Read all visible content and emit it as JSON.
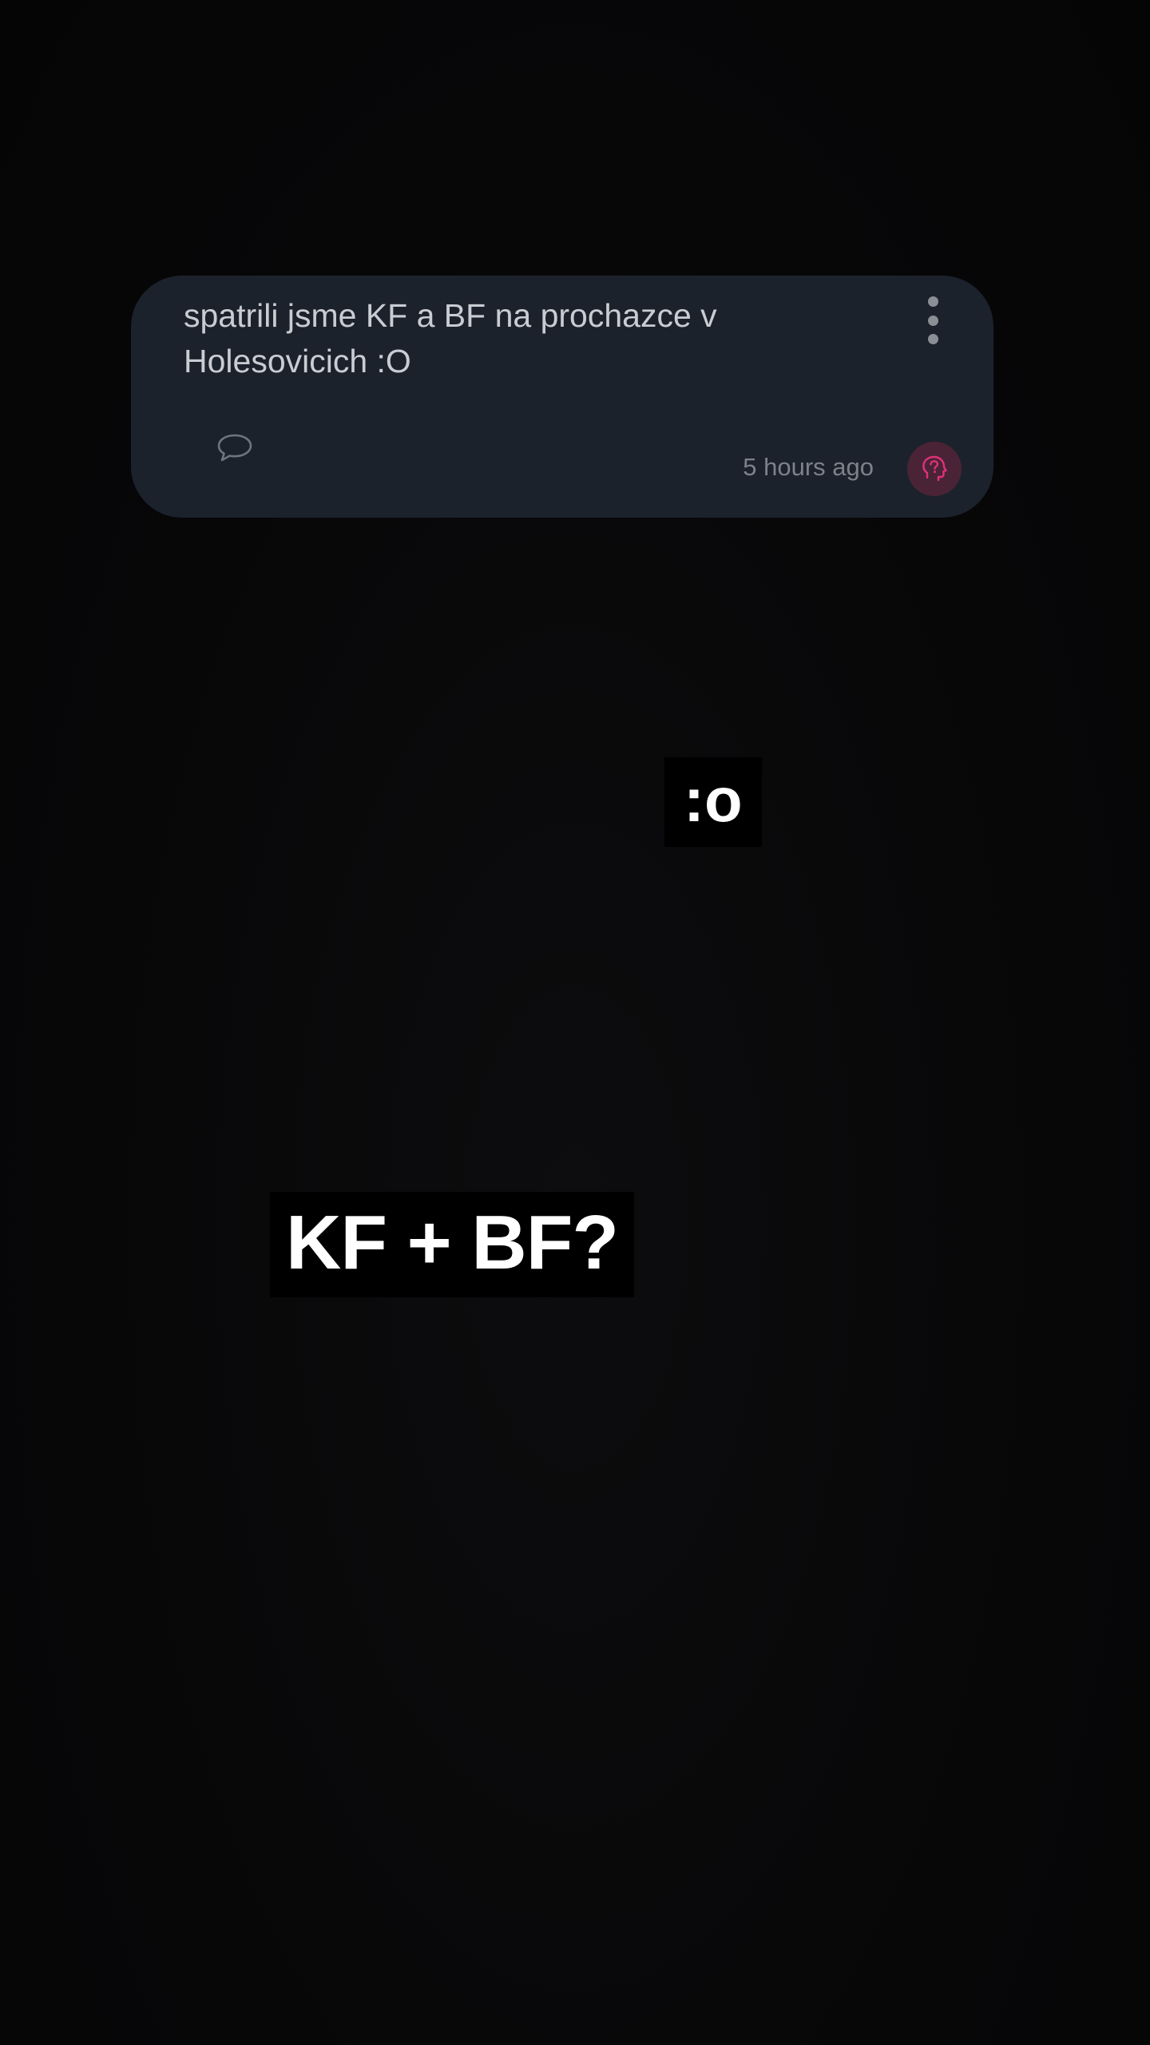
{
  "post": {
    "text": "spatrili jsme KF a BF na prochazce v Holesovicich :O",
    "timestamp": "5 hours ago",
    "icons": {
      "more": "more-vertical-icon",
      "comment": "comment-bubble-icon",
      "avatar": "question-head-icon"
    },
    "colors": {
      "card_bg": "#1c222c",
      "text": "#c9cdd3",
      "muted": "#7d828a",
      "avatar_bg": "#4a2436",
      "avatar_accent": "#e0307a"
    }
  },
  "stickers": {
    "face": ":o",
    "kfbf": "KF + BF?"
  },
  "background": {
    "color": "#060607"
  }
}
